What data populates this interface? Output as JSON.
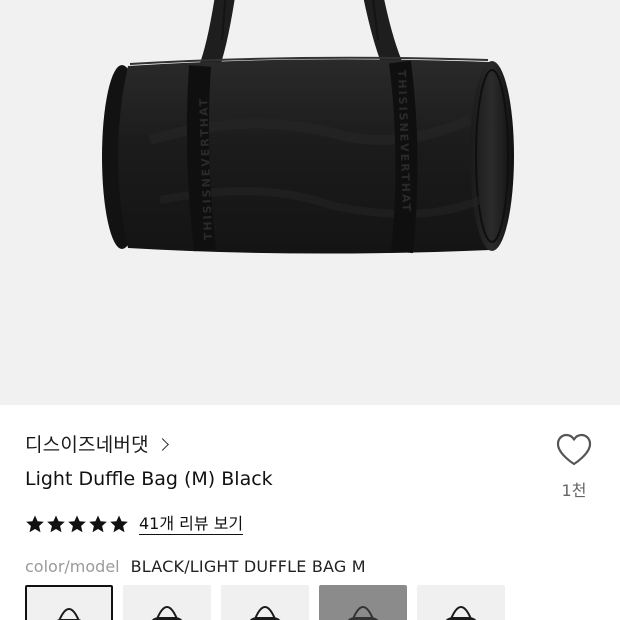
{
  "product": {
    "brand": "디스이즈네버댓",
    "title": "Light Duffle Bag (M) Black",
    "review_link": "41개 리뷰 보기",
    "rating_stars": 5,
    "like_count": "1천"
  },
  "hero": {
    "strap_text": "THISISNEVERTHAT",
    "background_color": "#f1f1f1",
    "bag_color": "#1c1c1c"
  },
  "options": {
    "label": "color/model",
    "value": "BLACK/LIGHT DUFFLE BAG M",
    "thumbnails": [
      {
        "name": "thumb-1",
        "selected": true
      },
      {
        "name": "thumb-2",
        "selected": false
      },
      {
        "name": "thumb-3",
        "selected": false
      },
      {
        "name": "thumb-4",
        "selected": false
      },
      {
        "name": "thumb-5",
        "selected": false
      }
    ]
  },
  "icons": {
    "star": "star-icon",
    "heart": "heart-icon",
    "chevron": "chevron-right-icon"
  }
}
